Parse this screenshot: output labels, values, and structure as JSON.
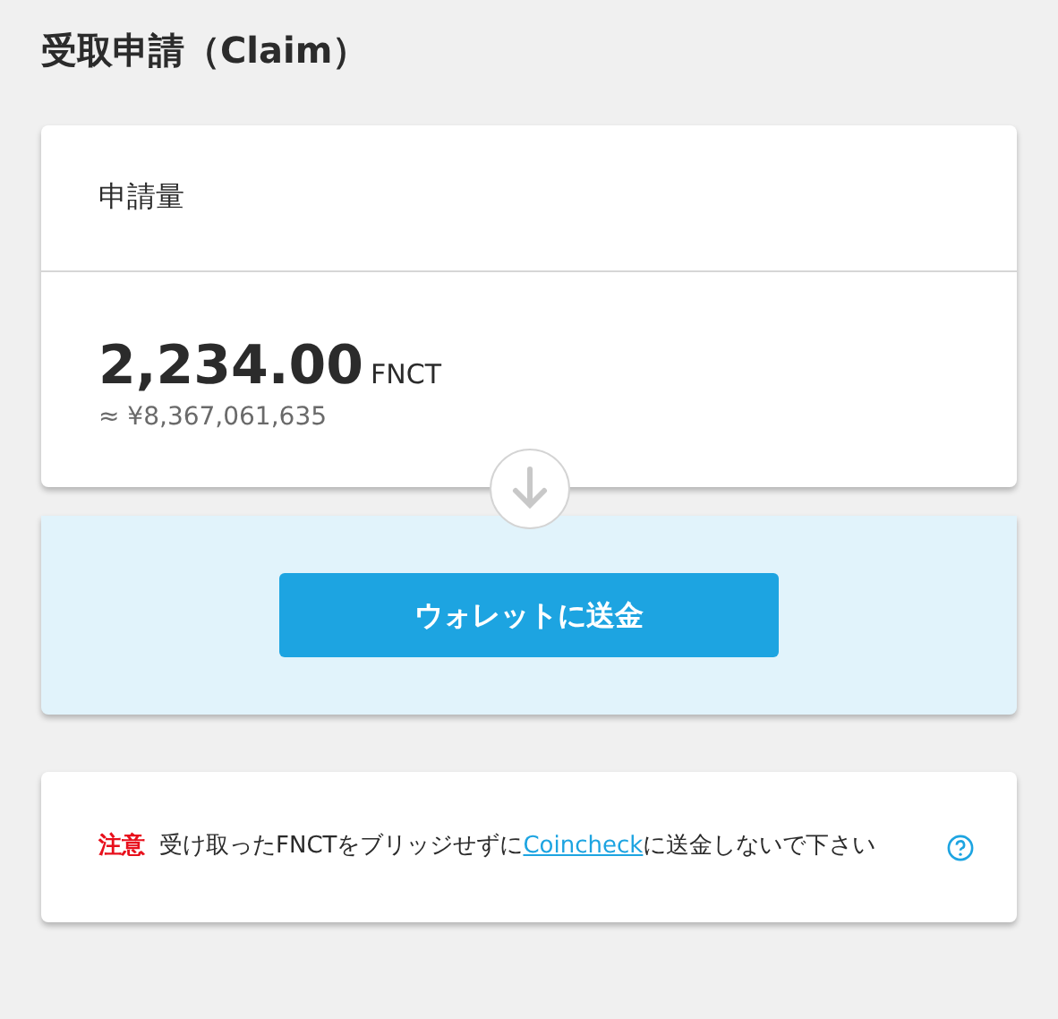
{
  "title": "受取申請（Claim）",
  "amount_card": {
    "label": "申請量",
    "amount": "2,234.00",
    "unit": "FNCT",
    "approx": "≈ ¥8,367,061,635"
  },
  "send_button": {
    "label": "ウォレットに送金"
  },
  "notice": {
    "tag": "注意",
    "text_before": "受け取ったFNCTをブリッジせずに",
    "link": "Coincheck",
    "text_after": "に送金しないで下さい"
  }
}
